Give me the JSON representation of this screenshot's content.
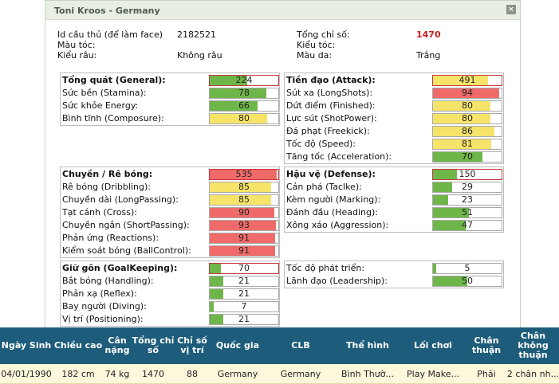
{
  "popup": {
    "title": "Toni Kroos - Germany",
    "close_label": "×"
  },
  "info": {
    "player_id_label": "Id cầu thủ (để làm face)",
    "player_id_value": "2182521",
    "hair_color_label": "Màu tóc:",
    "beard_label": "Kiểu râu:",
    "beard_value": "Không râu",
    "total_label": "Tổng chỉ số:",
    "total_value": "1470",
    "hair_style_label": "Kiểu tóc:",
    "skin_label": "Màu da:",
    "skin_value": "Trắng"
  },
  "colors": {
    "green": "#6fb64a",
    "red": "#f06a6a",
    "yellow": "#f6e46a",
    "header_bg": "#1d5c7a",
    "accent_red": "#c41e1e"
  },
  "panels": {
    "general": {
      "header": {
        "label": "Tổng quát (General):",
        "value": "224",
        "level": 0.55,
        "color": "green"
      },
      "rows": [
        {
          "label": "Sức bền (Stamina):",
          "value": "78",
          "level": 0.82,
          "color": "green"
        },
        {
          "label": "Sức khỏe Energy:",
          "value": "66",
          "level": 0.7,
          "color": "green"
        },
        {
          "label": "Bình tĩnh (Composure):",
          "value": "80",
          "level": 0.84,
          "color": "yellow"
        }
      ]
    },
    "attack": {
      "header": {
        "label": "Tiền đạo (Attack):",
        "value": "491",
        "level": 0.8,
        "color": "yellow"
      },
      "rows": [
        {
          "label": "Sút xa (LongShots):",
          "value": "94",
          "level": 0.97,
          "color": "red"
        },
        {
          "label": "Dứt điểm (Finished):",
          "value": "80",
          "level": 0.84,
          "color": "yellow"
        },
        {
          "label": "Lực sút (ShotPower):",
          "value": "80",
          "level": 0.84,
          "color": "yellow"
        },
        {
          "label": "Đá phạt (Freekick):",
          "value": "86",
          "level": 0.9,
          "color": "yellow"
        },
        {
          "label": "Tốc độ (Speed):",
          "value": "81",
          "level": 0.85,
          "color": "yellow"
        },
        {
          "label": "Tăng tốc (Acceleration):",
          "value": "70",
          "level": 0.72,
          "color": "green"
        }
      ]
    },
    "dribbling": {
      "header": {
        "label": "Chuyền / Rê bóng:",
        "value": "535",
        "level": 0.98,
        "color": "red"
      },
      "rows": [
        {
          "label": "Rê bóng (Dribbling):",
          "value": "85",
          "level": 0.89,
          "color": "yellow"
        },
        {
          "label": "Chuyền dài (LongPassing):",
          "value": "85",
          "level": 0.89,
          "color": "yellow"
        },
        {
          "label": "Tạt cánh (Cross):",
          "value": "90",
          "level": 0.94,
          "color": "red"
        },
        {
          "label": "Chuyền ngắn (ShortPassing):",
          "value": "93",
          "level": 0.97,
          "color": "red"
        },
        {
          "label": "Phản ứng (Reactions):",
          "value": "91",
          "level": 0.95,
          "color": "red"
        },
        {
          "label": "Kiểm soát bóng (BallControl):",
          "value": "91",
          "level": 0.95,
          "color": "red"
        }
      ]
    },
    "defense": {
      "header": {
        "label": "Hậu vệ (Defense):",
        "value": "150",
        "level": 0.35,
        "color": "green"
      },
      "rows": [
        {
          "label": "Cản phá (Taclke):",
          "value": "29",
          "level": 0.28,
          "color": "green"
        },
        {
          "label": "Kèm người (Marking):",
          "value": "23",
          "level": 0.22,
          "color": "green"
        },
        {
          "label": "Đánh đầu (Heading):",
          "value": "51",
          "level": 0.52,
          "color": "green"
        },
        {
          "label": "Xông xáo (Aggression):",
          "value": "47",
          "level": 0.48,
          "color": "green"
        }
      ]
    },
    "goalkeeping": {
      "header": {
        "label": "Giữ gôn (GoalKeeping):",
        "value": "70",
        "level": 0.16,
        "color": "green"
      },
      "rows": [
        {
          "label": "Bắt bóng (Handling):",
          "value": "21",
          "level": 0.2,
          "color": "green"
        },
        {
          "label": "Phản xạ (Reflex):",
          "value": "21",
          "level": 0.2,
          "color": "green"
        },
        {
          "label": "Bay người (Diving):",
          "value": "7",
          "level": 0.06,
          "color": "green"
        },
        {
          "label": "Vị trí (Positioning):",
          "value": "21",
          "level": 0.2,
          "color": "green"
        }
      ]
    },
    "other": {
      "rows": [
        {
          "label": "Tốc độ phát triển:",
          "value": "5",
          "level": 0.05,
          "color": "green"
        },
        {
          "label": "Lãnh đạo (Leadership):",
          "value": "50",
          "level": 0.5,
          "color": "green"
        }
      ]
    }
  },
  "table": {
    "headers": [
      "Ngày Sinh",
      "Chiều cao",
      "Cân nặng",
      "Tổng chỉ số",
      "Chỉ số vị trí",
      "Quốc gia",
      "CLB",
      "Thể hình",
      "Lối chơi",
      "Chân thuận",
      "Chân không thuận"
    ],
    "row": [
      "04/01/1990",
      "182 cm",
      "74 kg",
      "1470",
      "88",
      "Germany",
      "Germany",
      "Bình Thườ...",
      "Play Make...",
      "Phải",
      "2 chân nh..."
    ]
  }
}
